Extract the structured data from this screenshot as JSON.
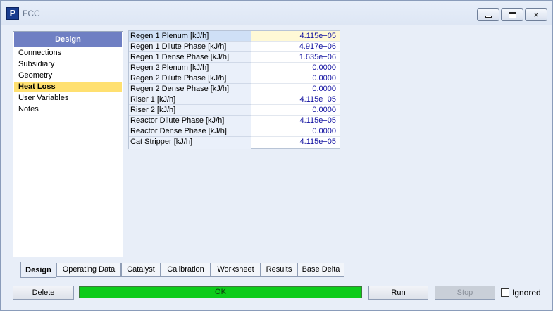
{
  "window": {
    "title": "FCC",
    "app_icon_glyph": "P",
    "controls": {
      "minimize": "minimize-icon",
      "maximize": "maximize-icon",
      "close": "×"
    }
  },
  "nav": {
    "header": "Design",
    "items": [
      {
        "label": "Connections",
        "selected": false
      },
      {
        "label": "Subsidiary",
        "selected": false
      },
      {
        "label": "Geometry",
        "selected": false
      },
      {
        "label": "Heat Loss",
        "selected": true
      },
      {
        "label": "User Variables",
        "selected": false
      },
      {
        "label": "Notes",
        "selected": false
      }
    ]
  },
  "grid": {
    "rows": [
      {
        "name": "Regen 1 Plenum [kJ/h]",
        "value": "4.115e+05"
      },
      {
        "name": "Regen 1 Dilute Phase [kJ/h]",
        "value": "4.917e+06"
      },
      {
        "name": "Regen 1 Dense Phase [kJ/h]",
        "value": "1.635e+06"
      },
      {
        "name": "Regen 2 Plenum [kJ/h]",
        "value": "0.0000"
      },
      {
        "name": "Regen 2 Dilute Phase [kJ/h]",
        "value": "0.0000"
      },
      {
        "name": "Regen 2 Dense Phase [kJ/h]",
        "value": "0.0000"
      },
      {
        "name": "Riser 1 [kJ/h]",
        "value": "4.115e+05"
      },
      {
        "name": "Riser 2 [kJ/h]",
        "value": "0.0000"
      },
      {
        "name": "Reactor Dilute Phase [kJ/h]",
        "value": "4.115e+05"
      },
      {
        "name": "Reactor Dense Phase [kJ/h]",
        "value": "0.0000"
      },
      {
        "name": "Cat Stripper [kJ/h]",
        "value": "4.115e+05"
      }
    ]
  },
  "tabs": [
    "Design",
    "Operating Data",
    "Catalyst",
    "Calibration",
    "Worksheet",
    "Results",
    "Base Delta"
  ],
  "active_tab": "Design",
  "footer": {
    "delete_label": "Delete",
    "status_text": "OK",
    "status_color": "#0dcc1a",
    "run_label": "Run",
    "stop_label": "Stop",
    "ignored_label": "Ignored",
    "ignored_checked": false
  }
}
